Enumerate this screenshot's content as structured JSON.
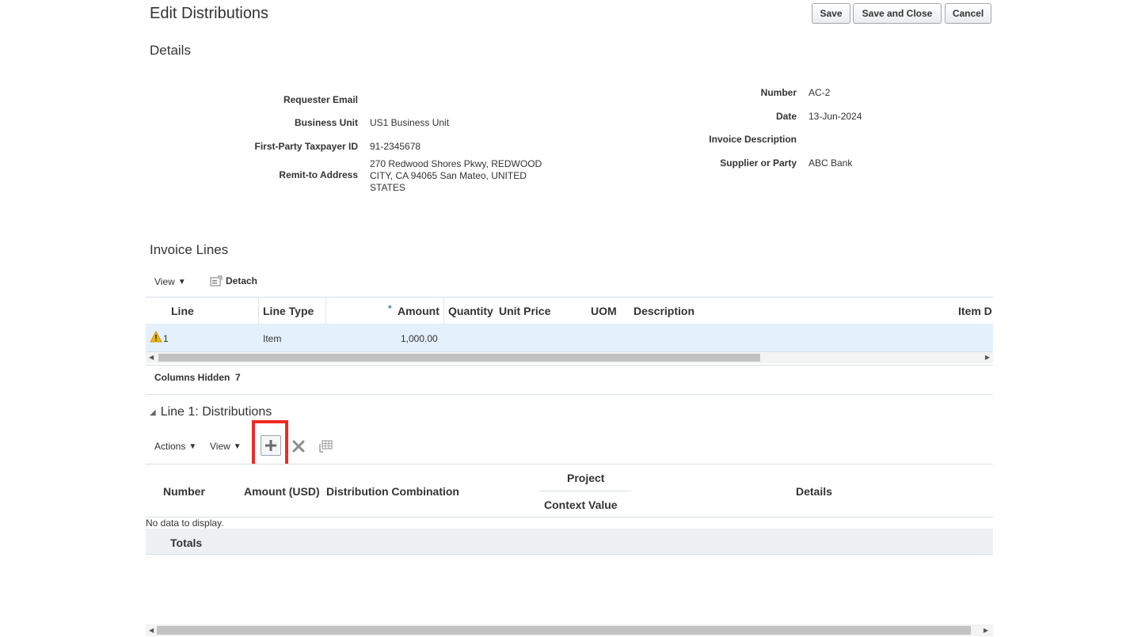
{
  "header": {
    "title": "Edit Distributions",
    "save_label": "Save",
    "save_close_label": "Save and Close",
    "cancel_label": "Cancel"
  },
  "details": {
    "section_title": "Details",
    "left": [
      {
        "label": "Requester Email",
        "value": ""
      },
      {
        "label": "Business Unit",
        "value": "US1 Business Unit"
      },
      {
        "label": "First-Party Taxpayer ID",
        "value": "91-2345678"
      },
      {
        "label": "Remit-to Address",
        "value_lines": [
          "270 Redwood Shores Pkwy, REDWOOD",
          "CITY, CA 94065 San Mateo, UNITED",
          "STATES"
        ]
      }
    ],
    "right": [
      {
        "label": "Number",
        "value": "AC-2"
      },
      {
        "label": "Date",
        "value": "13-Jun-2024"
      },
      {
        "label": "Invoice Description",
        "value": ""
      },
      {
        "label": "Supplier or Party",
        "value": "ABC Bank"
      }
    ]
  },
  "invoice_lines": {
    "section_title": "Invoice Lines",
    "toolbar": {
      "view_label": "View",
      "detach_label": "Detach"
    },
    "required_mark": "*",
    "columns": [
      "Line",
      "Line Type",
      "Amount",
      "Quantity",
      "Unit Price",
      "UOM",
      "Description",
      "Item D"
    ],
    "rows": [
      {
        "line": "1",
        "line_type": "Item",
        "amount": "1,000.00",
        "status_icon": "warning-icon"
      }
    ],
    "columns_hidden_label": "Columns Hidden",
    "columns_hidden_count": "7"
  },
  "distributions": {
    "section_title": "Line 1: Distributions",
    "toolbar": {
      "actions_label": "Actions",
      "view_label": "View",
      "add_icon": "plus-icon",
      "delete_icon": "x-icon",
      "freeze_icon": "freeze-icon"
    },
    "columns": {
      "number": "Number",
      "amount": "Amount (USD)",
      "distribution_combination": "Distribution Combination",
      "project_group": "Project",
      "context_value": "Context Value",
      "details": "Details"
    },
    "empty_text": "No data to display.",
    "totals_label": "Totals"
  },
  "colors": {
    "highlight": "#ee2a24",
    "selected_row": "#e4f0fb",
    "warning": "#f2b705"
  }
}
